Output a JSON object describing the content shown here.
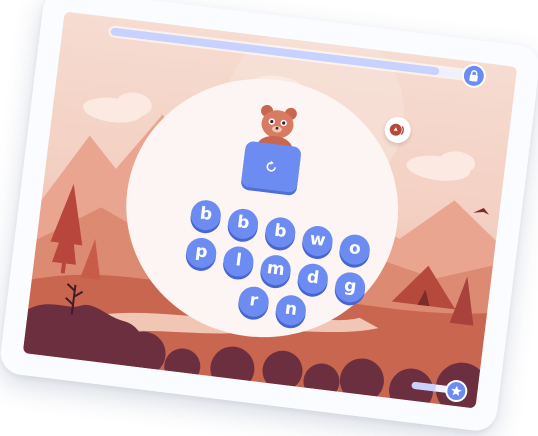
{
  "game": {
    "progress_percent": 92,
    "bottom_progress_percent": 60,
    "letters": [
      "b",
      "b",
      "b",
      "w",
      "o",
      "p",
      "l",
      "m",
      "d",
      "g",
      "r",
      "n"
    ]
  },
  "colors": {
    "tile_blue": "#6d8cf2",
    "circle_bg": "#fcf5f3",
    "scene_peach": "#f3cfc1",
    "scene_dark": "#6b2f3f"
  },
  "icons": {
    "progress_end": "lock-icon",
    "sound": "speaker-icon",
    "card": "replay-icon",
    "bottom": "star-icon"
  }
}
